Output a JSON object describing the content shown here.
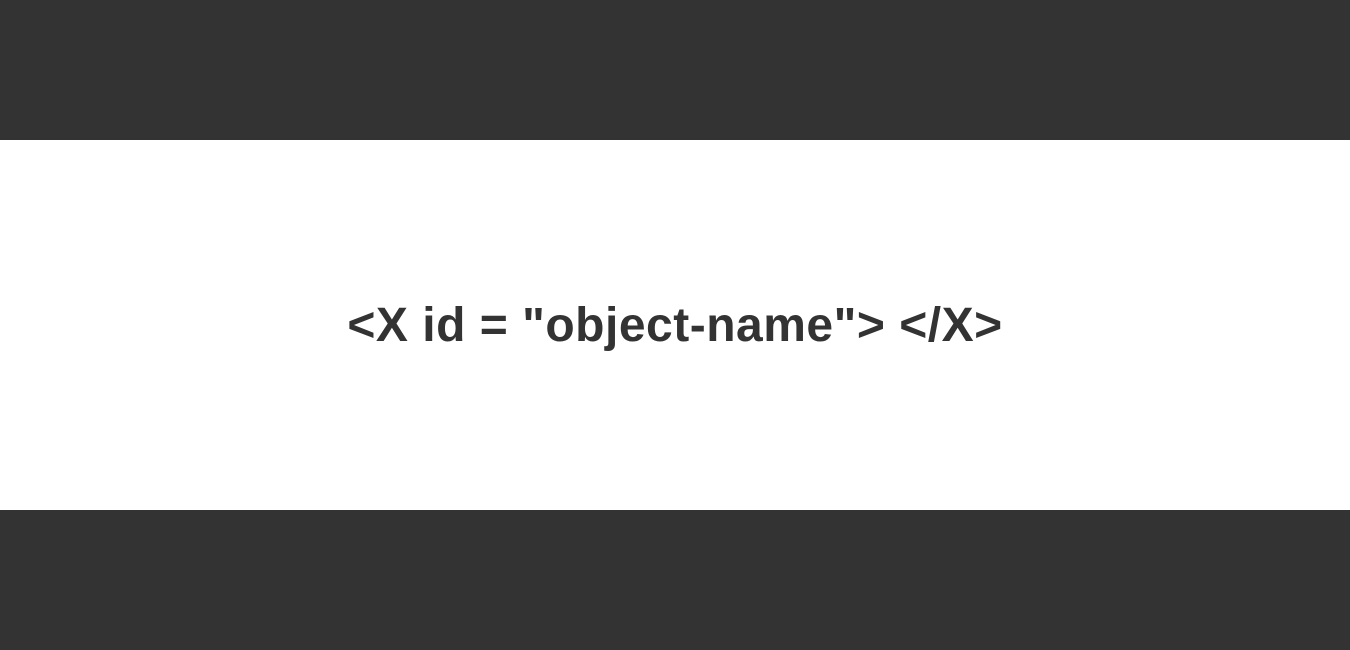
{
  "main": {
    "code_snippet": "<X id = \"object-name\"> </X>"
  },
  "colors": {
    "dark": "#333333",
    "light": "#ffffff"
  }
}
